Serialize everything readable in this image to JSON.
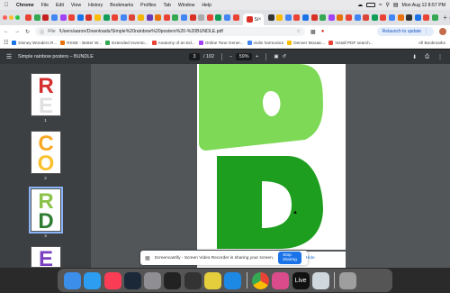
{
  "menubar": {
    "apple": "",
    "items": [
      "Chrome",
      "File",
      "Edit",
      "View",
      "History",
      "Bookmarks",
      "Profiles",
      "Tab",
      "Window",
      "Help"
    ],
    "clock": "Mon Aug 12  8:57 PM"
  },
  "tabs": {
    "active_title": "Si",
    "favicon_colors": [
      "#ea4335",
      "#34a853",
      "#c5221f",
      "#4285f4",
      "#a142f4",
      "#ea4335",
      "#1a73e8",
      "#d93025",
      "#fbbc04",
      "#0f9d58",
      "#ea4335",
      "#4285f4",
      "#db4437",
      "#f4b400",
      "#673ab7",
      "#e8710a",
      "#ea4335",
      "#34a853",
      "#4285f4",
      "#d93025",
      "#aaa",
      "#ea4335",
      "#0f9d58",
      "#4285f4",
      "#ea4335",
      "#333",
      "#fbbc04",
      "#4285f4",
      "#ea4335",
      "#1a73e8",
      "#d93025",
      "#34a853",
      "#a142f4",
      "#e8710a",
      "#ea4335",
      "#4285f4",
      "#db4437",
      "#0f9d58",
      "#ea4335",
      "#4285f4",
      "#e8710a",
      "#333",
      "#1a73e8",
      "#ea4335",
      "#34a853"
    ]
  },
  "toolbar": {
    "file_label": "File",
    "url": "/Users/aaron/Downloads/Simple%20rainbow%20posters%20-%20BUNDLE.pdf",
    "relaunch": "Relaunch to update"
  },
  "bookmarks": {
    "items": [
      {
        "label": "Disney Wonders R...",
        "color": "#1a73e8"
      },
      {
        "label": "RSSE - Better W...",
        "color": "#e8710a"
      },
      {
        "label": "Extended Invento...",
        "color": "#34a853"
      },
      {
        "label": "Anatomy of an Ed...",
        "color": "#ea4335"
      },
      {
        "label": "Online Tone Gener...",
        "color": "#a142f4"
      },
      {
        "label": "violin harmonics",
        "color": "#4285f4"
      },
      {
        "label": "Denver Mosaic...",
        "color": "#fbbc04"
      },
      {
        "label": "Install PDF search...",
        "color": "#ea4335"
      }
    ],
    "all": "All Bookmarks"
  },
  "pdf": {
    "title": "Simple rainbow posters – BUNDLE",
    "page": "3",
    "total": "/ 102",
    "zoom": "59%",
    "thumbs": [
      {
        "num": "1",
        "letters": [
          "R",
          "E"
        ],
        "colors": [
          "#d32f2f",
          "#e0e0e0"
        ]
      },
      {
        "num": "2",
        "letters": [
          "C",
          "O"
        ],
        "colors": [
          "#f9a825",
          "#fbc02d"
        ]
      },
      {
        "num": "3",
        "letters": [
          "R",
          "D"
        ],
        "colors": [
          "#8bc34a",
          "#2e7d32"
        ]
      },
      {
        "num": "4",
        "letters": [
          "E"
        ],
        "colors": [
          "#7b3fc0"
        ]
      }
    ],
    "page_colors": {
      "top": "#7ed957",
      "bottom": "#1e9e1e"
    }
  },
  "share_bar": {
    "text": "Screencastify - Screen Video Recorder is sharing your screen.",
    "stop": "Stop sharing",
    "hide": "Hide"
  },
  "dock": {
    "icons": [
      {
        "name": "finder",
        "color": "#3b8eea"
      },
      {
        "name": "safari",
        "color": "#2c9df0"
      },
      {
        "name": "music",
        "color": "#fa3c55"
      },
      {
        "name": "steam",
        "color": "#1b2838"
      },
      {
        "name": "settings",
        "color": "#8e8e93"
      },
      {
        "name": "camera-app",
        "color": "#222"
      },
      {
        "name": "dashboard",
        "color": "#333"
      },
      {
        "name": "photos",
        "color": "#e5ce3b"
      },
      {
        "name": "preview",
        "color": "#1e88e5"
      },
      {
        "name": "chrome",
        "color": "#ffffff"
      },
      {
        "name": "music-app",
        "color": "#d94b8b"
      },
      {
        "name": "live",
        "color": "#111"
      },
      {
        "name": "screenshot",
        "color": "#cfd8dc"
      }
    ],
    "live_label": "Live"
  }
}
